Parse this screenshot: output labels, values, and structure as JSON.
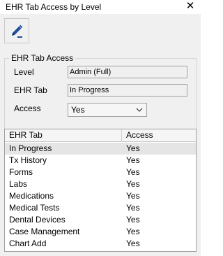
{
  "window": {
    "title": "EHR Tab Access by Level",
    "close_glyph": "✕"
  },
  "toolbar": {
    "edit_icon": "pencil-edit-icon"
  },
  "group": {
    "legend": "EHR Tab Access",
    "level_label": "Level",
    "level_value": "Admin (Full)",
    "tab_label": "EHR Tab",
    "tab_value": "In Progress",
    "access_label": "Access",
    "access_value": "Yes"
  },
  "grid": {
    "columns": [
      "EHR Tab",
      "Access"
    ],
    "selected_index": 0,
    "rows": [
      {
        "tab": "In Progress",
        "access": "Yes"
      },
      {
        "tab": "Tx History",
        "access": "Yes"
      },
      {
        "tab": "Forms",
        "access": "Yes"
      },
      {
        "tab": "Labs",
        "access": "Yes"
      },
      {
        "tab": "Medications",
        "access": "Yes"
      },
      {
        "tab": "Medical Tests",
        "access": "Yes"
      },
      {
        "tab": "Dental Devices",
        "access": "Yes"
      },
      {
        "tab": "Case Management",
        "access": "Yes"
      },
      {
        "tab": "Chart Add",
        "access": "Yes"
      }
    ]
  },
  "colors": {
    "edit_icon": "#1f4e9c",
    "selected_row": "#e5e5e5",
    "client_bg": "#f0f0f0"
  }
}
